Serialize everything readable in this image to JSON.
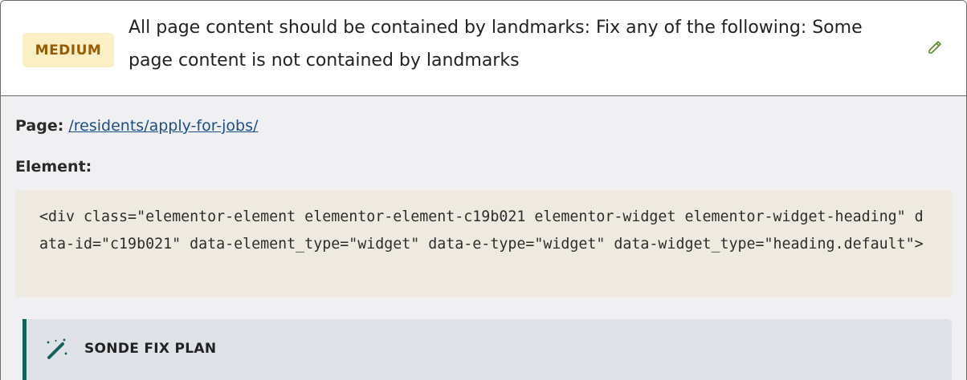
{
  "issue": {
    "severity": "MEDIUM",
    "title": "All page content should be contained by landmarks: Fix any of the following: Some page content is not contained by landmarks",
    "edit_icon": "pencil-icon"
  },
  "details": {
    "page_label": "Page:",
    "page_link": "/residents/apply-for-jobs/",
    "element_label": "Element:",
    "element_code": "<div class=\"elementor-element elementor-element-c19b021 elementor-widget elementor-widget-heading\" data-id=\"c19b021\" data-element_type=\"widget\" data-e-type=\"widget\" data-widget_type=\"heading.default\">"
  },
  "fix_plan": {
    "icon": "magic-wand-icon",
    "title": "SONDE FIX PLAN"
  },
  "colors": {
    "badge_bg": "#fbefc6",
    "badge_text": "#9a5b00",
    "accent": "#14625a",
    "link": "#1b4f8a"
  }
}
